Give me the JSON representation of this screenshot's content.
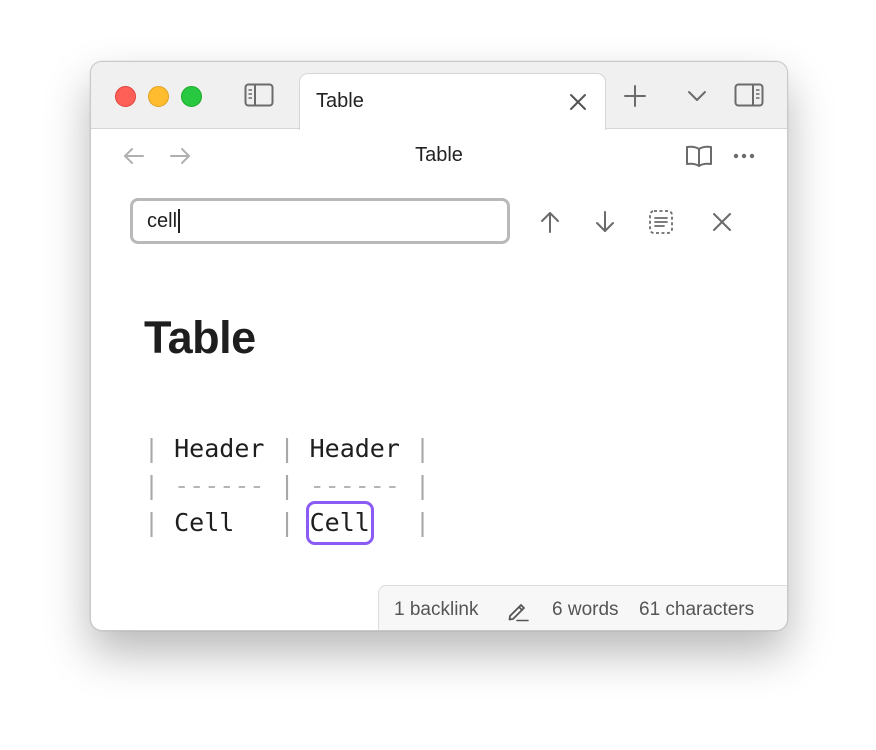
{
  "tab": {
    "title": "Table"
  },
  "navbar": {
    "title": "Table"
  },
  "search": {
    "value": "cell"
  },
  "document": {
    "heading": "Table",
    "table_lines": [
      [
        "|",
        " Header ",
        "|",
        " Header ",
        "|"
      ],
      [
        "|",
        " ------ ",
        "|",
        " ------ ",
        "|"
      ],
      [
        "|",
        " Cell   ",
        "|",
        " Cell   ",
        "|"
      ]
    ],
    "match_text": "Cell"
  },
  "status": {
    "backlinks": "1 backlink",
    "words": "6 words",
    "characters": "61 characters"
  },
  "icons": {
    "sidebar_left": "sidebar-left-icon",
    "close_tab": "close-icon",
    "new_tab": "plus-icon",
    "tab_list": "chevron-down-icon",
    "sidebar_right": "sidebar-right-icon",
    "back": "arrow-left-icon",
    "forward": "arrow-right-icon",
    "reading_view": "book-icon",
    "more": "more-options-icon",
    "prev_match": "arrow-up-icon",
    "next_match": "arrow-down-icon",
    "select_all_matches": "select-all-icon",
    "close_search": "close-icon",
    "edit": "pencil-icon"
  },
  "colors": {
    "match_highlight": "#8a5cf5",
    "traffic_red": "#fe5f57",
    "traffic_yellow": "#febc2e",
    "traffic_green": "#28c840"
  }
}
